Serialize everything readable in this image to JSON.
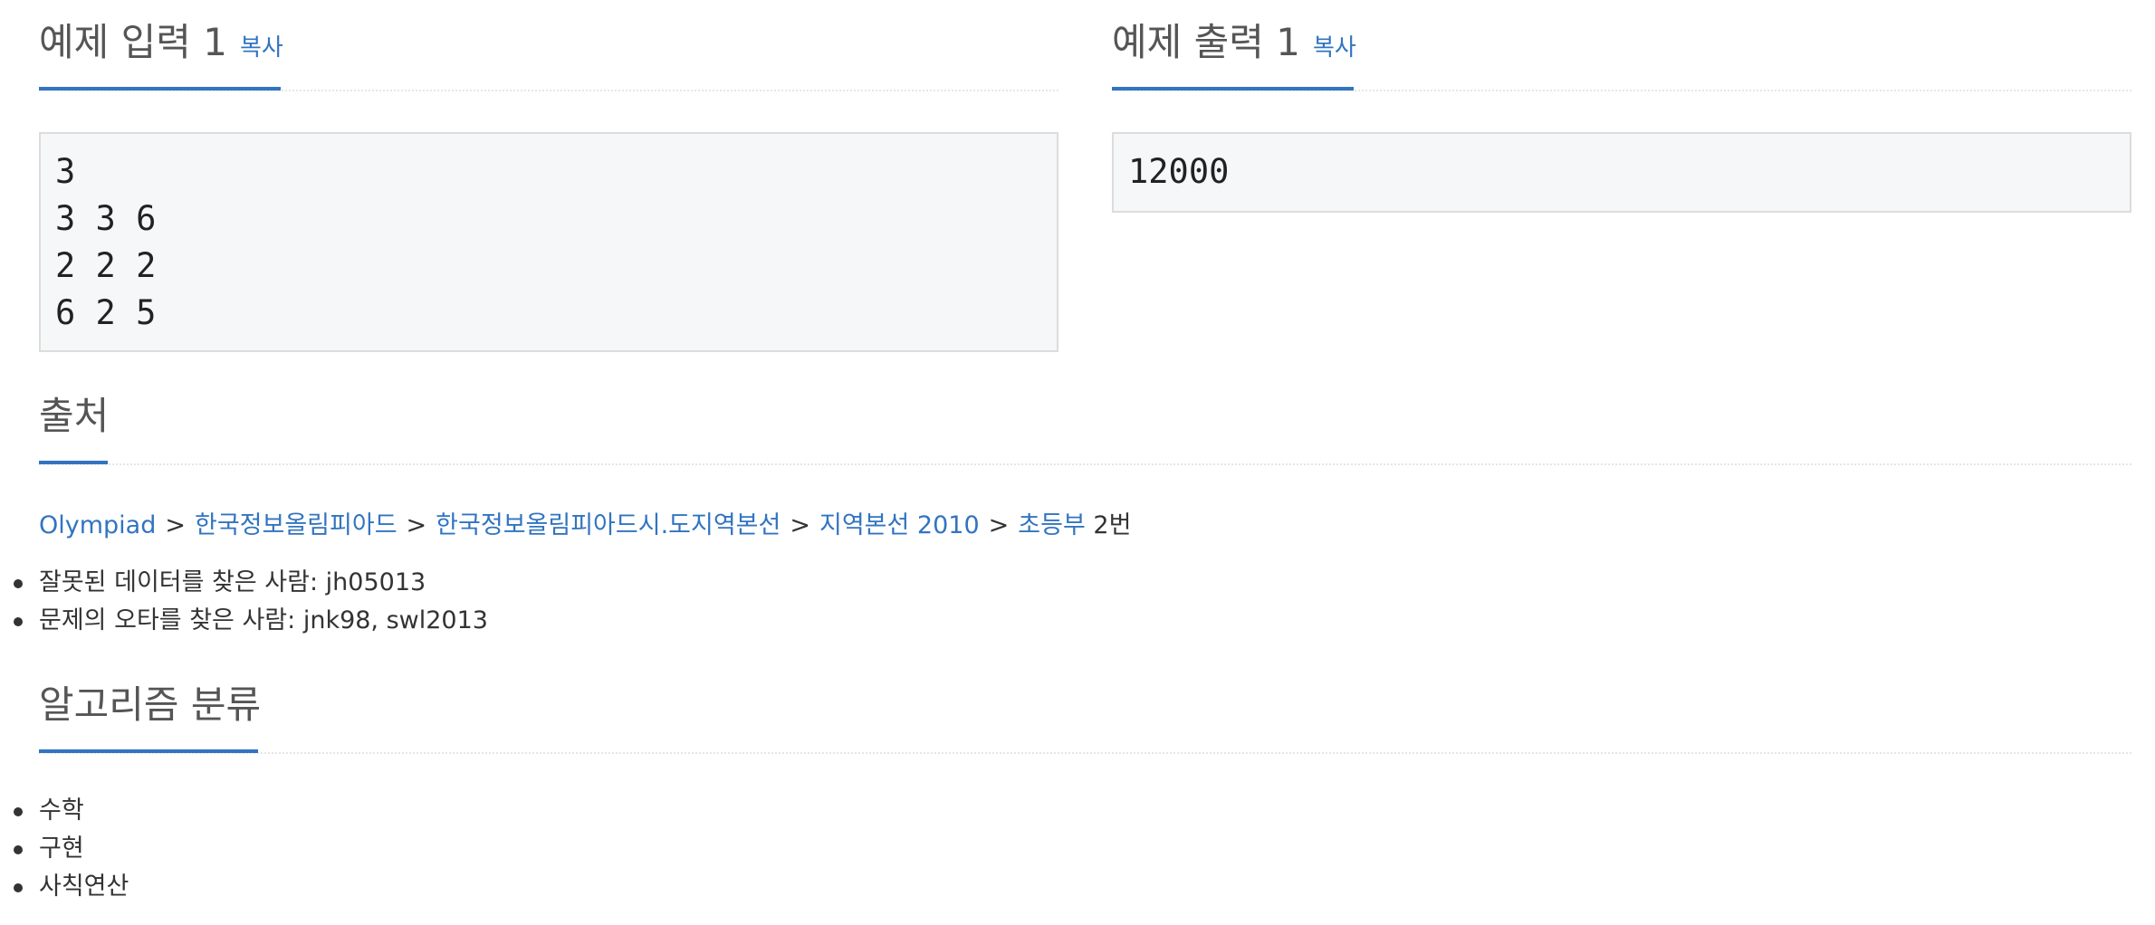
{
  "sample_input": {
    "title": "예제 입력 1",
    "copy_label": "복사",
    "content": "3\n3 3 6\n2 2 2\n6 2 5"
  },
  "sample_output": {
    "title": "예제 출력 1",
    "copy_label": "복사",
    "content": "12000"
  },
  "source": {
    "title": "출처",
    "breadcrumb": [
      "Olympiad",
      "한국정보올림피아드",
      "한국정보올림피아드시.도지역본선",
      "지역본선 2010",
      "초등부"
    ],
    "separator": ">",
    "suffix": "2번",
    "credits": [
      "잘못된 데이터를 찾은 사람: jh05013",
      "문제의 오타를 찾은 사람: jnk98, swl2013"
    ]
  },
  "algorithm": {
    "title": "알고리즘 분류",
    "tags": [
      "수학",
      "구현",
      "사칙연산"
    ]
  },
  "colors": {
    "link": "#3274c1",
    "heading": "#555555",
    "sample_background": "#f6f7f9"
  }
}
